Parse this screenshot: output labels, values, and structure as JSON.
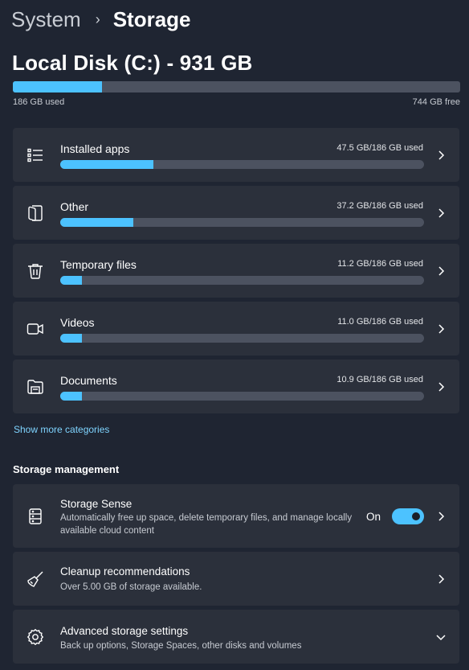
{
  "breadcrumb": {
    "parent": "System",
    "separator": "›",
    "current": "Storage"
  },
  "disk": {
    "title": "Local Disk (C:) - 931 GB",
    "used_label": "186 GB used",
    "free_label": "744 GB free",
    "used_fraction": 0.2
  },
  "categories": [
    {
      "label": "Installed apps",
      "usage": "47.5 GB/186 GB used",
      "fraction": 0.255,
      "icon": "list-icon"
    },
    {
      "label": "Other",
      "usage": "37.2 GB/186 GB used",
      "fraction": 0.2,
      "icon": "other-files-icon"
    },
    {
      "label": "Temporary files",
      "usage": "11.2 GB/186 GB used",
      "fraction": 0.06,
      "icon": "trash-icon"
    },
    {
      "label": "Videos",
      "usage": "11.0 GB/186 GB used",
      "fraction": 0.059,
      "icon": "video-camera-icon"
    },
    {
      "label": "Documents",
      "usage": "10.9 GB/186 GB used",
      "fraction": 0.059,
      "icon": "documents-folder-icon"
    }
  ],
  "show_more": "Show more categories",
  "management": {
    "title": "Storage management",
    "storage_sense": {
      "title": "Storage Sense",
      "description": "Automatically free up space, delete temporary files, and manage locally available cloud content",
      "toggle_label": "On",
      "enabled": true
    },
    "cleanup": {
      "title": "Cleanup recommendations",
      "description": "Over 5.00 GB of storage available."
    },
    "advanced": {
      "title": "Advanced storage settings",
      "description": "Back up options, Storage Spaces, other disks and volumes"
    }
  },
  "colors": {
    "accent": "#4cc2ff",
    "background": "#1f2532",
    "card": "#2b303b",
    "track": "#4c5260",
    "link": "#7fd4ff"
  }
}
